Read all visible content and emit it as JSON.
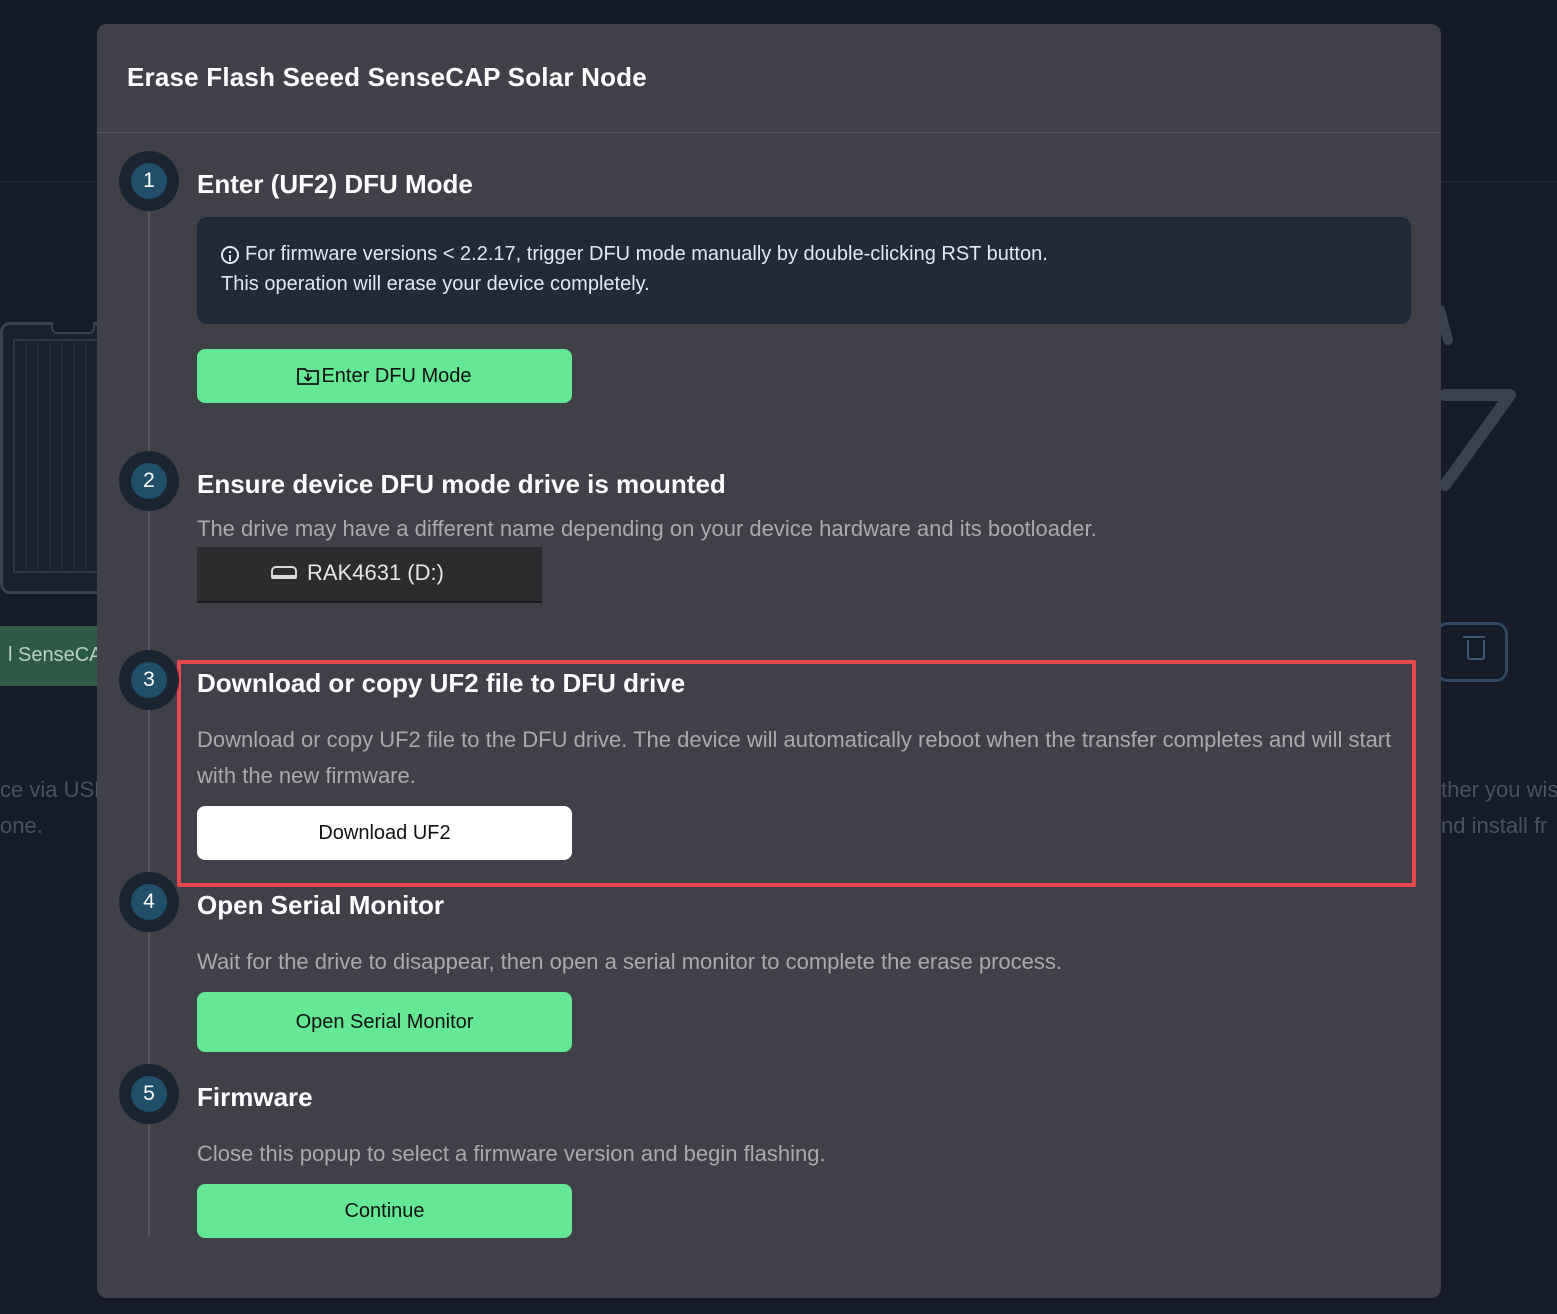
{
  "background": {
    "chip_label": "l SenseCAP",
    "left_text": [
      "ce via USB",
      "one."
    ],
    "right_text": [
      "ther you wis",
      "nd install fr"
    ]
  },
  "modal": {
    "title": "Erase Flash Seeed SenseCAP Solar Node"
  },
  "steps": [
    {
      "number": "1",
      "title": "Enter (UF2) DFU Mode",
      "info_line1": "For firmware versions < 2.2.17, trigger DFU mode manually by double-clicking RST button.",
      "info_line2": "This operation will erase your device completely.",
      "button_label": "Enter DFU Mode",
      "button_icon": "folder-download-icon"
    },
    {
      "number": "2",
      "title": "Ensure device DFU mode drive is mounted",
      "description": "The drive may have a different name depending on your device hardware and its bootloader.",
      "drive_label": "RAK4631 (D:)",
      "drive_icon": "drive-icon"
    },
    {
      "number": "3",
      "title": "Download or copy UF2 file to DFU drive",
      "description": "Download or copy UF2 file to the DFU drive. The device will automatically reboot when the transfer completes and will start with the new firmware.",
      "button_label": "Download UF2"
    },
    {
      "number": "4",
      "title": "Open Serial Monitor",
      "description": "Wait for the drive to disappear, then open a serial monitor to complete the erase process.",
      "button_label": "Open Serial Monitor"
    },
    {
      "number": "5",
      "title": "Firmware",
      "description": "Close this popup to select a firmware version and begin flashing.",
      "button_label": "Continue"
    }
  ],
  "colors": {
    "accent_green": "#64e893",
    "step_badge": "#1f4f6a",
    "highlight_border": "#e5484d",
    "modal_bg": "#3f4048"
  }
}
